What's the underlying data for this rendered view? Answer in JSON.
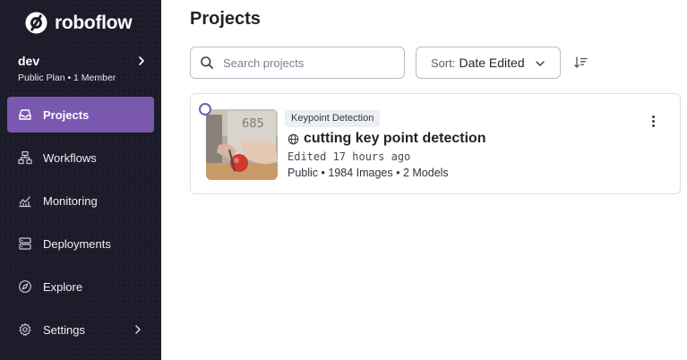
{
  "brand": {
    "name": "roboflow"
  },
  "workspace": {
    "name": "dev",
    "plan": "Public Plan • 1 Member"
  },
  "nav": [
    {
      "label": "Projects",
      "icon": "inbox-icon",
      "active": true
    },
    {
      "label": "Workflows",
      "icon": "workflow-icon"
    },
    {
      "label": "Monitoring",
      "icon": "monitoring-icon"
    },
    {
      "label": "Deployments",
      "icon": "server-icon"
    },
    {
      "label": "Explore",
      "icon": "compass-icon"
    },
    {
      "label": "Settings",
      "icon": "gear-icon"
    }
  ],
  "main": {
    "title": "Projects",
    "search_placeholder": "Search projects",
    "sort_prefix": "Sort:",
    "sort_value": "Date Edited"
  },
  "projects": [
    {
      "tag": "Keypoint Detection",
      "name": "cutting key point detection",
      "edited": "Edited 17 hours ago",
      "meta": "Public • 1984 Images • 2 Models"
    }
  ],
  "colors": {
    "sidebar_bg": "#1b1b2a",
    "accent": "#7a58b0"
  }
}
